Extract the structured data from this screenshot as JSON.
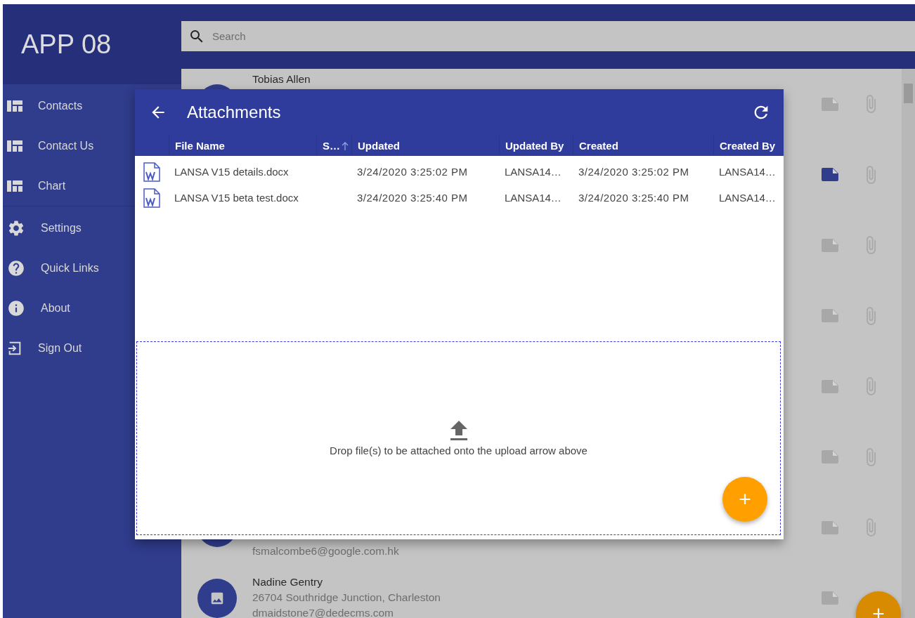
{
  "app_title": "APP 08",
  "search": {
    "placeholder": "Search"
  },
  "sidebar": {
    "groups": [
      [
        {
          "label": "Contacts"
        },
        {
          "label": "Contact Us"
        },
        {
          "label": "Chart"
        }
      ],
      [
        {
          "label": "Settings"
        },
        {
          "label": "Quick Links"
        },
        {
          "label": "About"
        },
        {
          "label": "Sign Out"
        }
      ]
    ]
  },
  "contacts": [
    {
      "name": "Tobias Allen",
      "has_note": false
    },
    {
      "has_note": true
    },
    {
      "has_note": false
    },
    {
      "has_note": false
    },
    {
      "has_note": false
    },
    {
      "has_note": false
    },
    {
      "email": "fsmalcombe6@google.com.hk",
      "has_note": false
    },
    {
      "name": "Nadine Gentry",
      "address": "26704 Southridge Junction, Charleston",
      "email": "dmaidstone7@dedecms.com",
      "has_note": false
    }
  ],
  "fab": {
    "label": "+"
  },
  "dialog": {
    "title": "Attachments",
    "columns": [
      {
        "label": "File Name",
        "sorted": false
      },
      {
        "label": "S…",
        "sorted": true
      },
      {
        "label": "Updated",
        "sorted": false
      },
      {
        "label": "Updated By",
        "sorted": false
      },
      {
        "label": "Created",
        "sorted": false
      },
      {
        "label": "Created By",
        "sorted": false
      }
    ],
    "rows": [
      {
        "cells": [
          "LANSA V15 details.docx",
          "",
          "3/24/2020 3:25:02 PM",
          "LANSA14…",
          "3/24/2020 3:25:02 PM",
          "LANSA14…"
        ]
      },
      {
        "cells": [
          "LANSA V15 beta test.docx",
          "",
          "3/24/2020 3:25:40 PM",
          "LANSA14…",
          "3/24/2020 3:25:40 PM",
          "LANSA14…"
        ]
      }
    ],
    "dropzone": {
      "text": "Drop file(s) to be attached onto the upload arrow above"
    },
    "fab": {
      "label": "+"
    }
  }
}
